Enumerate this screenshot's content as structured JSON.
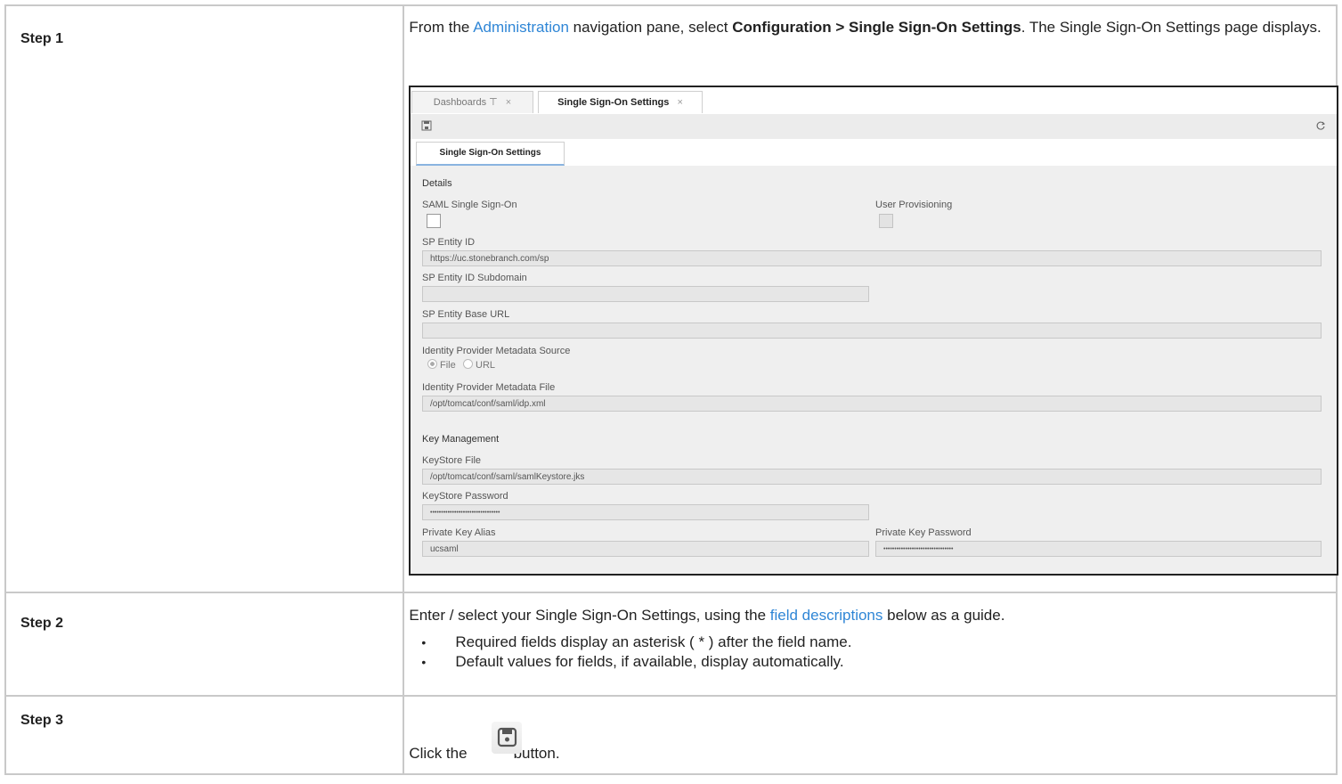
{
  "rows": [
    {
      "label": "Step 1"
    },
    {
      "label": "Step 2"
    },
    {
      "label": "Step 3"
    }
  ],
  "step1": {
    "prefix": "From the ",
    "link": "Administration",
    "middle": " navigation pane, select ",
    "bold": "Configuration > Single Sign-On Settings",
    "suffix": ". The Single Sign-On Settings page displays."
  },
  "screenshot": {
    "tabs": [
      {
        "label": "Dashboards",
        "pin": "⊤",
        "close": "×"
      },
      {
        "label": "Single Sign-On Settings",
        "close": "×"
      }
    ],
    "subtab": "Single Sign-On Settings",
    "details_title": "Details",
    "saml_label": "SAML Single Sign-On",
    "user_prov_label": "User Provisioning",
    "sp_entity_id_label": "SP Entity ID",
    "sp_entity_id_value": "https://uc.stonebranch.com/sp",
    "sp_subdomain_label": "SP Entity ID Subdomain",
    "sp_base_url_label": "SP Entity Base URL",
    "idp_source_label": "Identity Provider Metadata Source",
    "radio_file": "File",
    "radio_url": "URL",
    "idp_file_label": "Identity Provider Metadata File",
    "idp_file_value": "/opt/tomcat/conf/saml/idp.xml",
    "key_mgmt_title": "Key Management",
    "keystore_file_label": "KeyStore File",
    "keystore_file_value": "/opt/tomcat/conf/saml/samlKeystore.jks",
    "keystore_pw_label": "KeyStore Password",
    "keystore_pw_value": "••••••••••••••••••••••••••••••••",
    "pk_alias_label": "Private Key Alias",
    "pk_alias_value": "ucsaml",
    "pk_pw_label": "Private Key Password",
    "pk_pw_value": "••••••••••••••••••••••••••••••••"
  },
  "step2": {
    "prefix": "Enter / select your Single Sign-On Settings, using the ",
    "link": "field descriptions",
    "suffix": " below as a guide.",
    "bullets": [
      "Required fields display an asterisk ( * ) after the field name.",
      "Default values for fields, if available, display automatically."
    ]
  },
  "step3": {
    "prefix": "Click the",
    "suffix": "button."
  },
  "colors": {
    "link": "#2f86d6",
    "border": "#c9c9c9"
  }
}
